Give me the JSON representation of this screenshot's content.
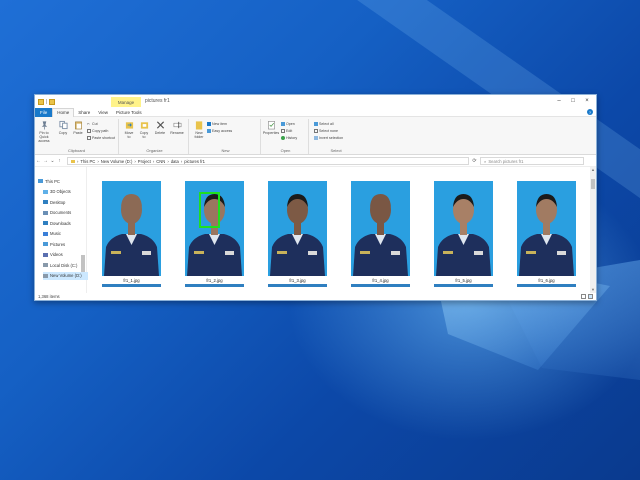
{
  "window": {
    "manage_tab": "Manage",
    "title": "pictures fr1"
  },
  "menu": {
    "file": "File",
    "home": "Home",
    "share": "Share",
    "view": "View",
    "picture_tools": "Picture Tools"
  },
  "ribbon": {
    "clipboard": {
      "label": "Clipboard",
      "pin": "Pin to Quick access",
      "copy": "Copy",
      "paste": "Paste",
      "cut": "Cut",
      "copy_path": "Copy path",
      "paste_shortcut": "Paste shortcut"
    },
    "organize": {
      "label": "Organize",
      "move_to": "Move to",
      "copy_to": "Copy to",
      "delete": "Delete",
      "rename": "Rename"
    },
    "new": {
      "label": "New",
      "new_folder": "New folder",
      "new_item": "New item",
      "easy_access": "Easy access"
    },
    "open": {
      "label": "Open",
      "properties": "Properties",
      "open": "Open",
      "edit": "Edit",
      "history": "History"
    },
    "select": {
      "label": "Select",
      "select_all": "Select all",
      "select_none": "Select none",
      "invert": "Invert selection"
    }
  },
  "address": {
    "path": [
      "This PC",
      "New Volume (D:)",
      "Project",
      "CNN",
      "data",
      "pictures fr1"
    ],
    "search_placeholder": "Search pictures fr1"
  },
  "nav": {
    "items": [
      {
        "label": "This PC",
        "icon": "computer-icon"
      },
      {
        "label": "3D Objects",
        "icon": "cube-icon"
      },
      {
        "label": "Desktop",
        "icon": "desktop-icon"
      },
      {
        "label": "Documents",
        "icon": "documents-icon"
      },
      {
        "label": "Downloads",
        "icon": "download-icon"
      },
      {
        "label": "Music",
        "icon": "music-icon"
      },
      {
        "label": "Pictures",
        "icon": "pictures-icon"
      },
      {
        "label": "Videos",
        "icon": "videos-icon"
      },
      {
        "label": "Local Disk (C:)",
        "icon": "disk-icon"
      },
      {
        "label": "New Volume (D:)",
        "icon": "disk-icon"
      }
    ]
  },
  "files": [
    {
      "name": "fr1_1.jpg",
      "skin": "#8c6a55",
      "bald": true
    },
    {
      "name": "fr1_2.jpg",
      "skin": "#9a7660",
      "bald": false,
      "selected_face": true
    },
    {
      "name": "fr1_3.jpg",
      "skin": "#7d5a45",
      "bald": false
    },
    {
      "name": "fr1_4.jpg",
      "skin": "#7a5744",
      "bald": true
    },
    {
      "name": "fr1_5.jpg",
      "skin": "#a88066",
      "bald": false
    },
    {
      "name": "fr1_6.jpg",
      "skin": "#a17b62",
      "bald": false
    }
  ],
  "status": {
    "items": "1,368 items"
  },
  "colors": {
    "accent": "#1979ca",
    "face_box": "#1fe01f",
    "photo_bg": "#2a9fe0",
    "uniform": "#1e2f5c"
  }
}
